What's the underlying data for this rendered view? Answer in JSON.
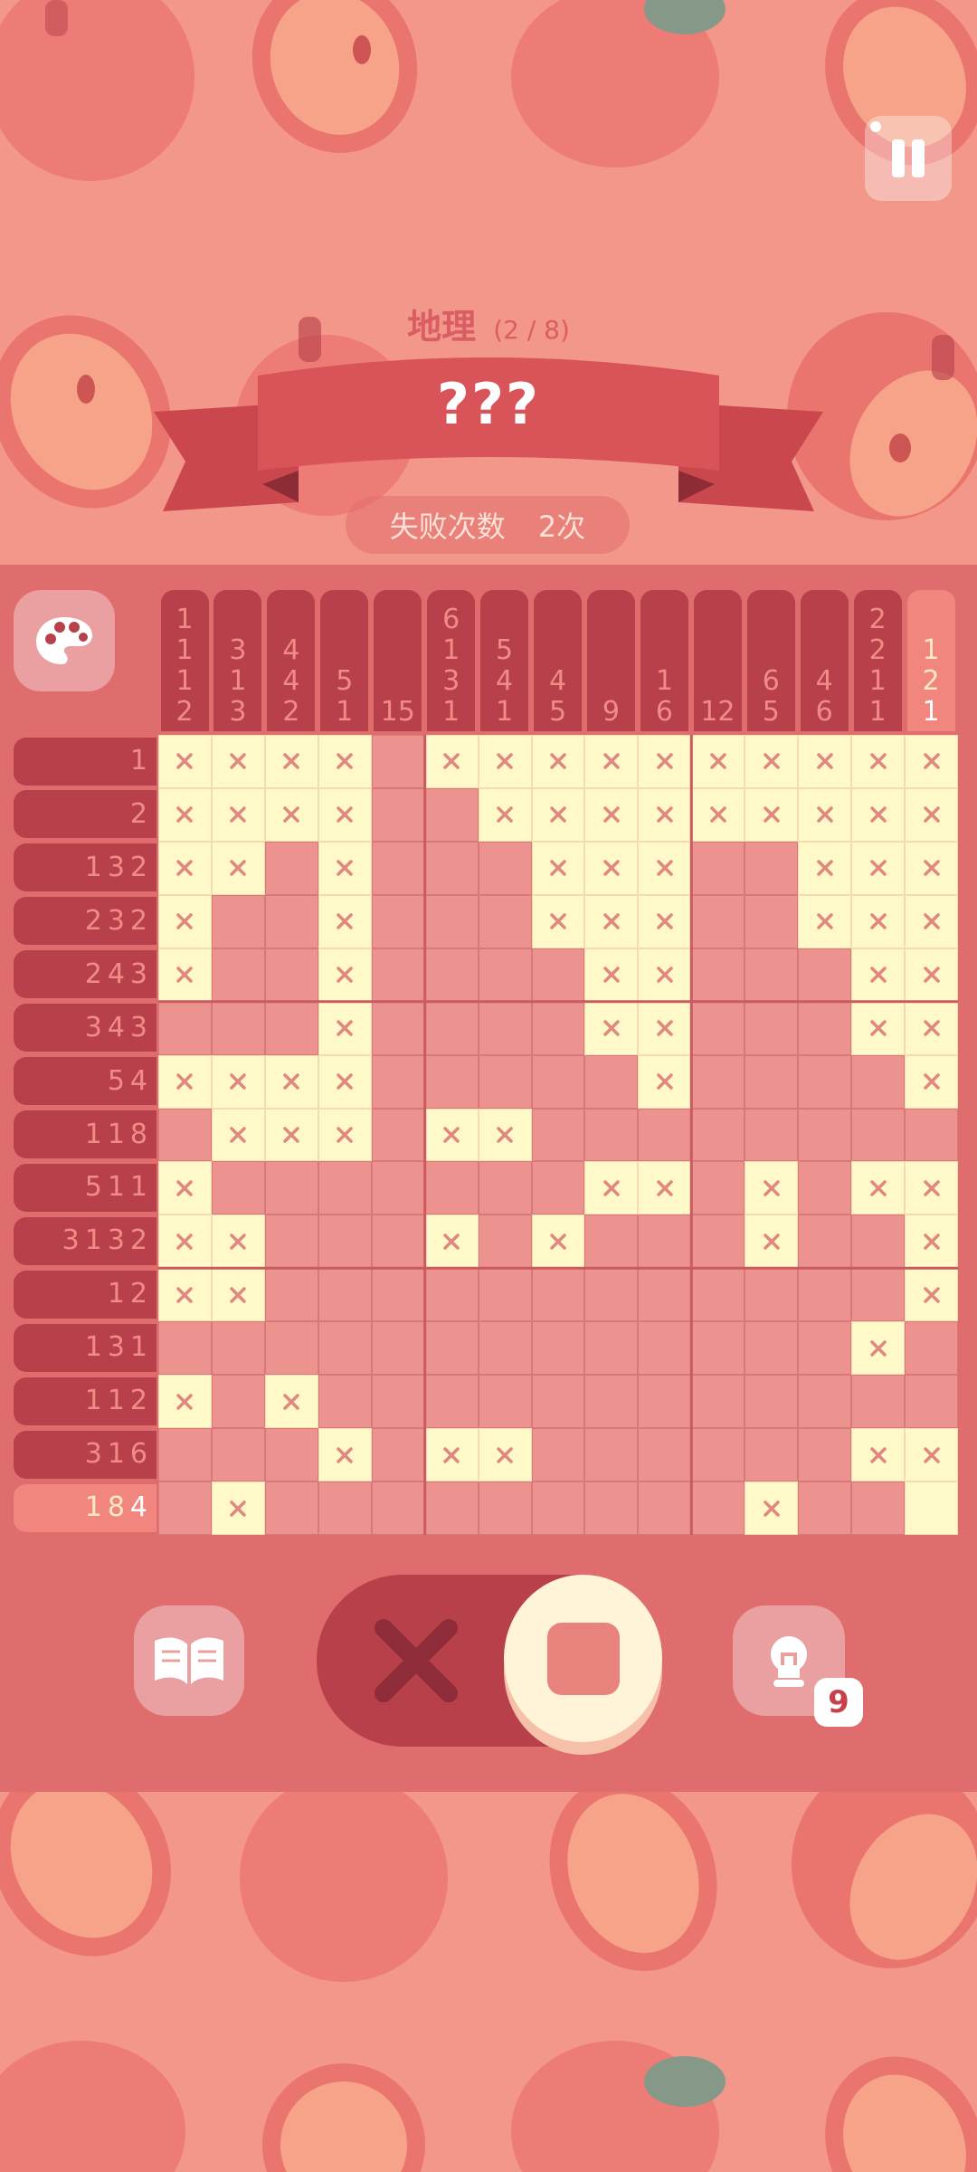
{
  "header": {
    "title": "地理",
    "progress": "(2 / 8)",
    "puzzle_name": "???",
    "fail_label": "失败次数",
    "fail_count": "2次"
  },
  "column_clues": [
    [
      "1",
      "1",
      "1",
      "2"
    ],
    [
      "3",
      "1",
      "3"
    ],
    [
      "4",
      "4",
      "2"
    ],
    [
      "5",
      "1"
    ],
    [
      "15"
    ],
    [
      "6",
      "1",
      "3",
      "1"
    ],
    [
      "5",
      "4",
      "1"
    ],
    [
      "4",
      "5"
    ],
    [
      "9"
    ],
    [
      "1",
      "6"
    ],
    [
      "12"
    ],
    [
      "6",
      "5"
    ],
    [
      "4",
      "6"
    ],
    [
      "2",
      "2",
      "1",
      "1"
    ],
    [
      "1",
      "2",
      "1"
    ]
  ],
  "row_clues": [
    [
      "1"
    ],
    [
      "2"
    ],
    [
      "1",
      "3",
      "2"
    ],
    [
      "2",
      "3",
      "2"
    ],
    [
      "2",
      "4",
      "3"
    ],
    [
      "3",
      "4",
      "3"
    ],
    [
      "5",
      "4"
    ],
    [
      "1",
      "1",
      "8"
    ],
    [
      "5",
      "1",
      "1"
    ],
    [
      "3",
      "1",
      "3",
      "2"
    ],
    [
      "1",
      "2"
    ],
    [
      "1",
      "3",
      "1"
    ],
    [
      "1",
      "1",
      "2"
    ],
    [
      "3",
      "1",
      "6"
    ],
    [
      "1",
      "8",
      "4"
    ]
  ],
  "highlight": {
    "row": 14,
    "col": 14,
    "row_done_count": 1,
    "col_done_count": 1
  },
  "grid": [
    "XXXX.XXXXXXXXXX",
    "XXXX..XXXXXXXXX",
    "XX.X...XXX..XXX",
    "X..X...XXX..XXX",
    "X..X....XX...XX",
    "...X....XX...XX",
    "XXXX.....X....X",
    ".XXX.XX........",
    "X.......XX.X.XXXX",
    "XX...X.X...X..X",
    "XX............X",
    ".............X.",
    "X.X............",
    "...X.XX......XX",
    ".X.........X..O"
  ],
  "controls": {
    "book_icon": "book-icon",
    "cross_icon": "cross-mode-icon",
    "fill_icon": "fill-mode-icon",
    "hint_icon": "lightbulb-icon",
    "hint_count": "9"
  },
  "colors": {
    "background": "#f2978a",
    "board": "#df6d6d",
    "clue_bar": "#b8404a",
    "crossed_cell": "#fff8c8",
    "cross_mark": "#e0877f",
    "empty_cell": "#ec9390"
  }
}
